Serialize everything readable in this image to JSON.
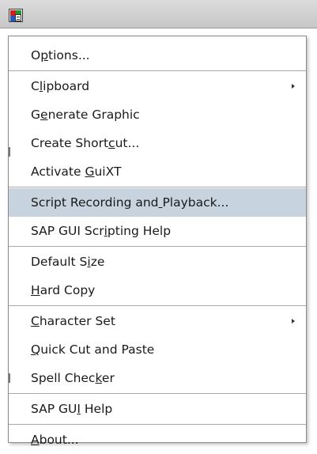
{
  "window": {
    "system_icon": "sap-gui-system-icon"
  },
  "menu": {
    "groups": [
      [
        {
          "label": "Options...",
          "mnemonic_index": 1
        }
      ],
      [
        {
          "label": "Clipboard",
          "mnemonic_index": 1,
          "submenu": true
        },
        {
          "label": "Generate Graphic",
          "mnemonic_index": 1
        },
        {
          "label": "Create Shortcut...",
          "mnemonic_index": 12
        },
        {
          "label": "Activate GuiXT",
          "mnemonic_index": 9
        }
      ],
      [
        {
          "label": "Script Recording and Playback...",
          "mnemonic_index": 20,
          "highlighted": true
        },
        {
          "label": "SAP GUI Scripting Help",
          "mnemonic_index": 11
        }
      ],
      [
        {
          "label": "Default Size",
          "mnemonic_index": 9
        },
        {
          "label": "Hard Copy",
          "mnemonic_index": 0
        }
      ],
      [
        {
          "label": "Character Set",
          "mnemonic_index": 0,
          "submenu": true
        },
        {
          "label": "Quick Cut and Paste",
          "mnemonic_index": 0
        },
        {
          "label": "Spell Checker",
          "mnemonic_index": 10
        }
      ],
      [
        {
          "label": "SAP GUI Help",
          "mnemonic_index": 6
        }
      ],
      [
        {
          "label": "About...",
          "mnemonic_index": 0
        }
      ]
    ],
    "highlight_color": "#c7d3df",
    "submenu_arrow_icon": "triangle-right-icon"
  }
}
